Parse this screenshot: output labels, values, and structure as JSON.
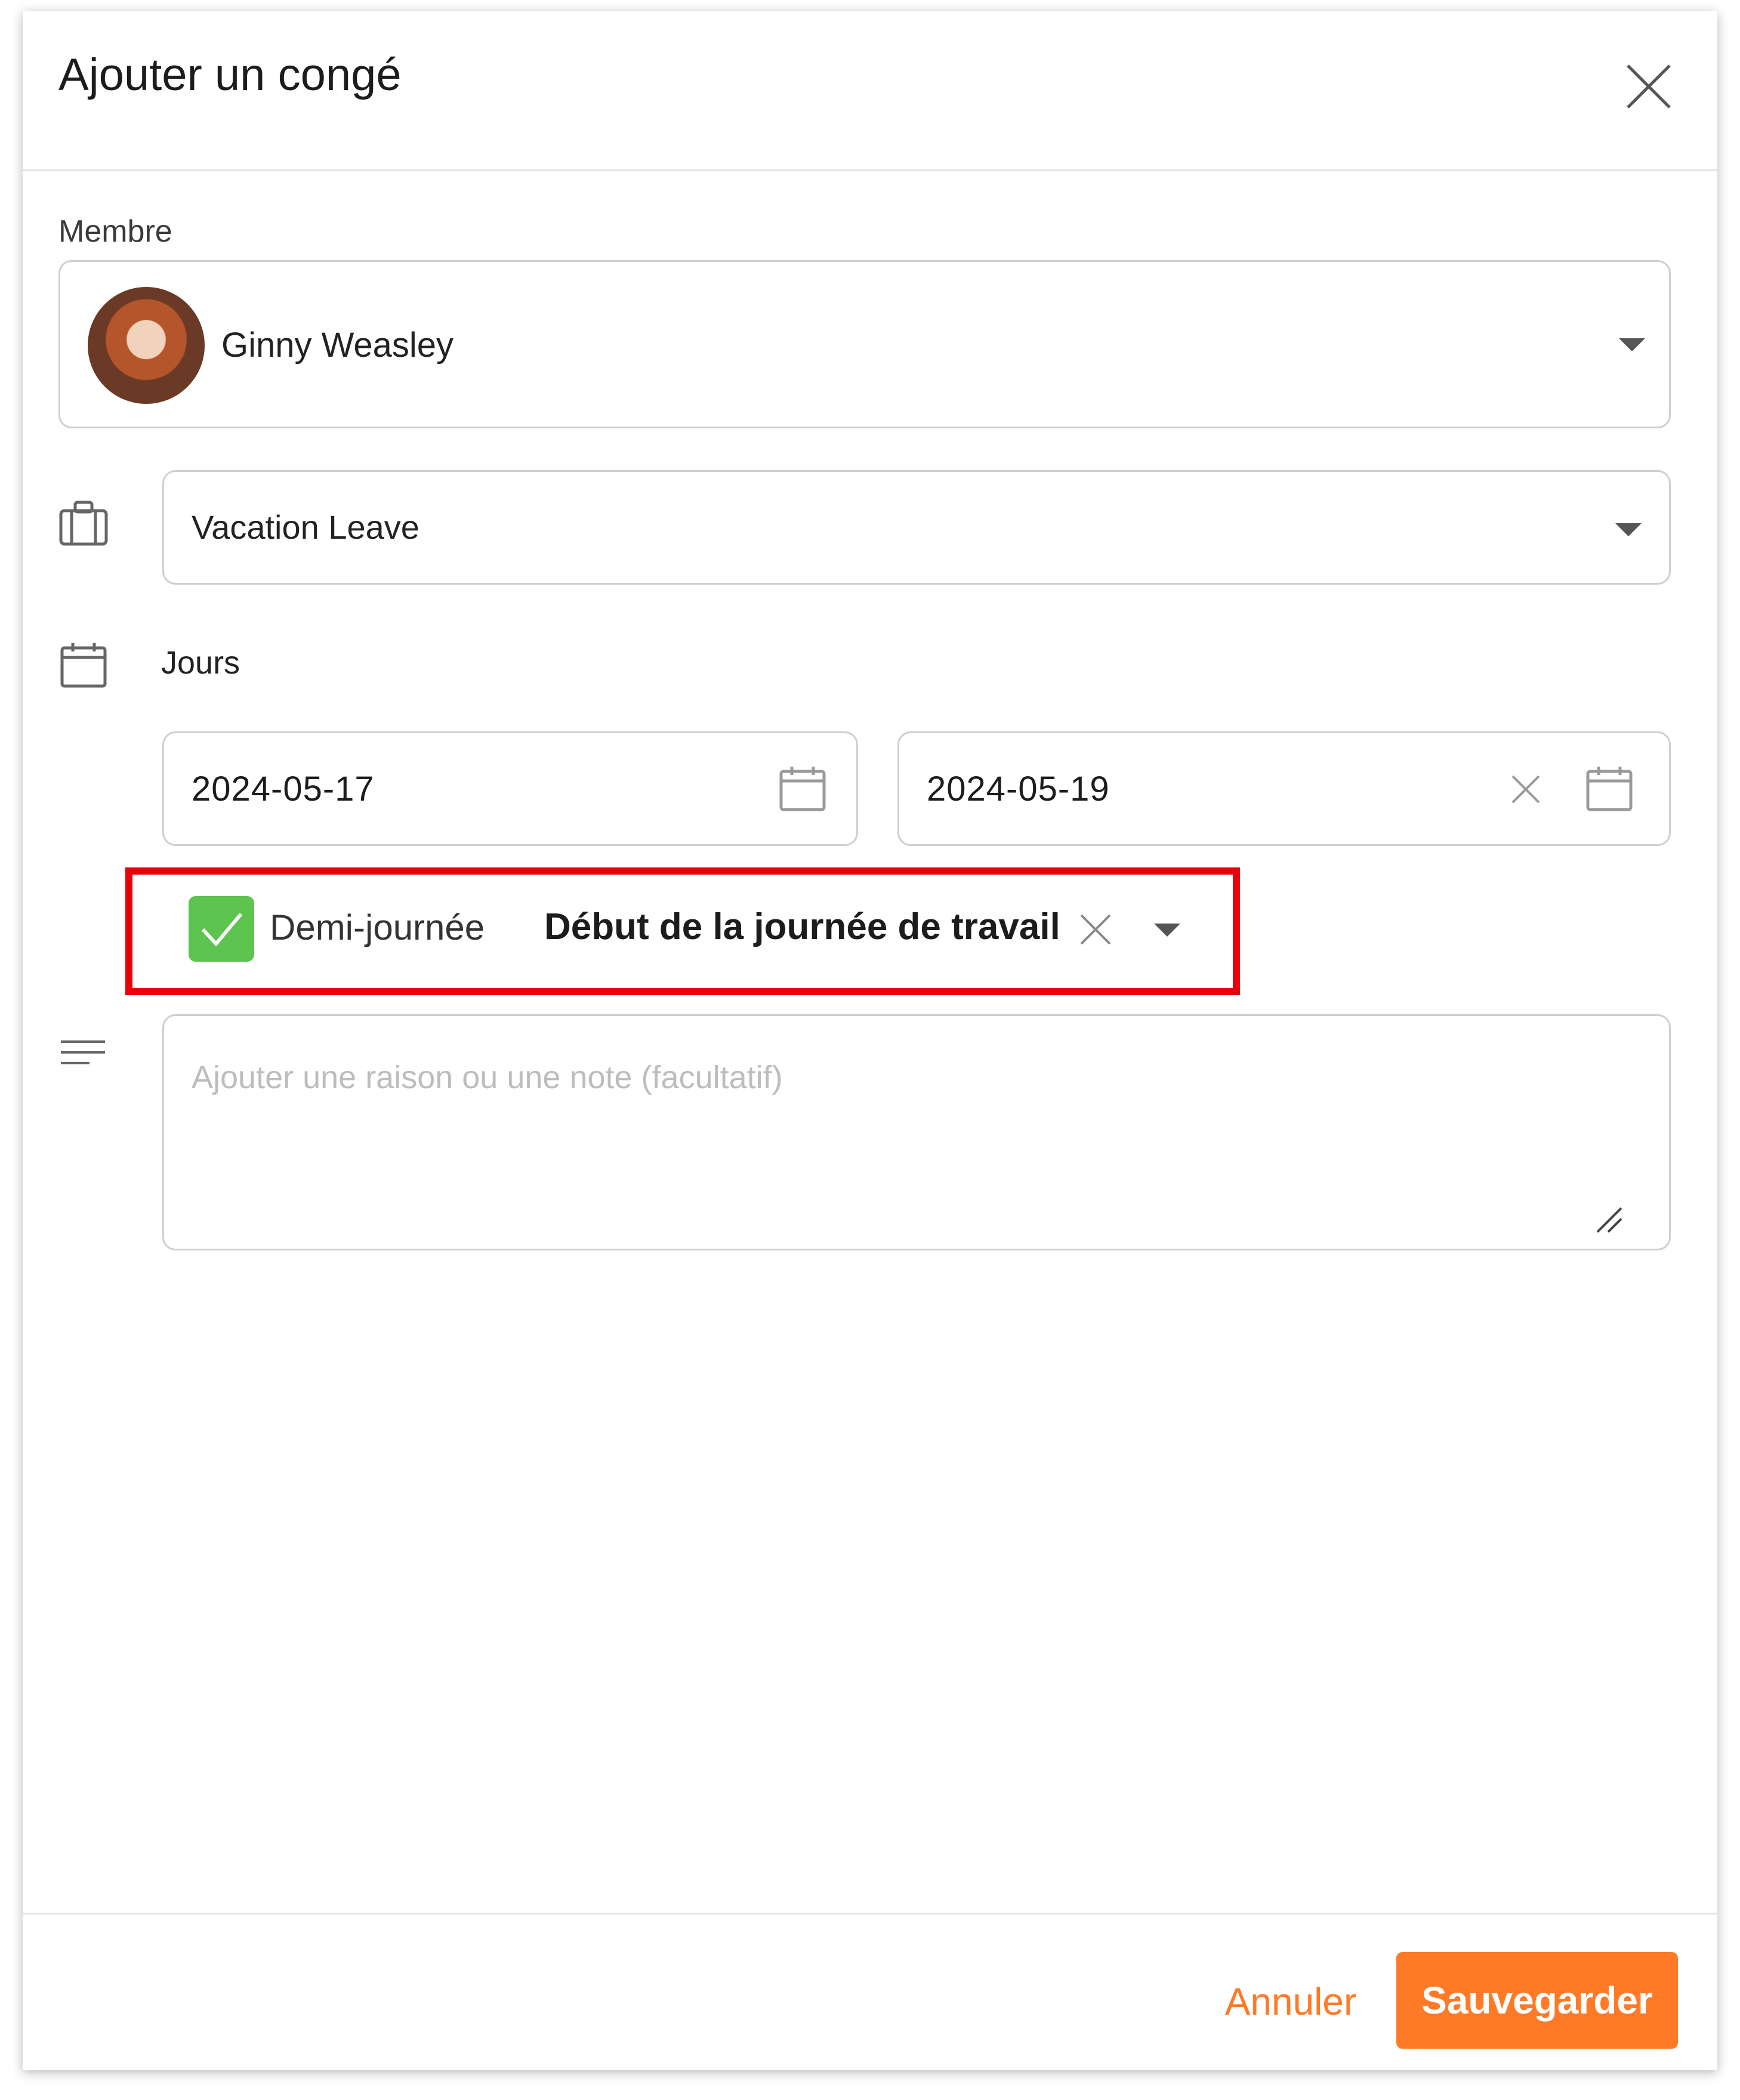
{
  "dialog": {
    "title": "Ajouter un congé",
    "close_icon": "close-icon"
  },
  "member": {
    "label": "Membre",
    "name": "Ginny Weasley"
  },
  "leave_type": {
    "icon": "briefcase-icon",
    "value": "Vacation Leave"
  },
  "days": {
    "icon": "calendar-icon",
    "label": "Jours",
    "start_date": "2024-05-17",
    "end_date": "2024-05-19"
  },
  "half_day": {
    "checked": true,
    "label": "Demi-journée",
    "period": "Début de la journée de travail"
  },
  "note": {
    "icon": "text-lines-icon",
    "placeholder": "Ajouter une raison ou une note (facultatif)"
  },
  "footer": {
    "cancel_label": "Annuler",
    "save_label": "Sauvegarder"
  },
  "colors": {
    "accent": "#ff7a26",
    "check": "#5cc44f",
    "highlight": "#e8000b"
  }
}
